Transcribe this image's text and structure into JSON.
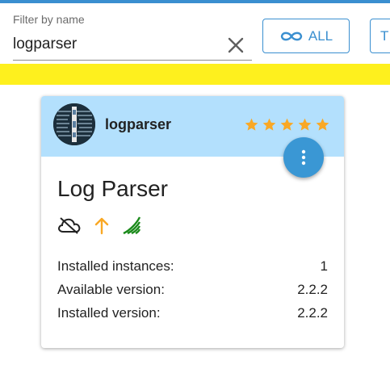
{
  "filter": {
    "label": "Filter by name",
    "value": "logparser"
  },
  "buttons": {
    "all_label": "ALL",
    "next_label": "T"
  },
  "card": {
    "adapter_name": "logparser",
    "rating_stars": 5,
    "title": "Log Parser",
    "details": [
      {
        "label": "Installed instances:",
        "value": "1"
      },
      {
        "label": "Available version:",
        "value": "2.2.2"
      },
      {
        "label": "Installed version:",
        "value": "2.2.2"
      }
    ],
    "status_icons": [
      "cloud-off-icon",
      "update-arrow-icon",
      "signal-icon"
    ]
  },
  "colors": {
    "accent": "#3a8fd0",
    "header_bg": "#b3e0fd",
    "banner": "#fef01e",
    "star": "#f9a825",
    "update": "#f9a825",
    "signal": "#1a8a1a"
  }
}
